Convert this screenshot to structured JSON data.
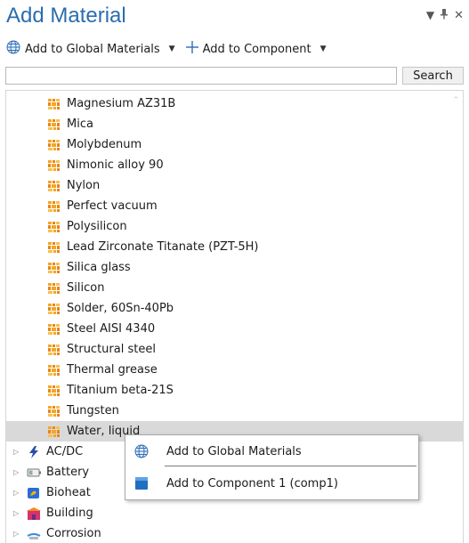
{
  "header": {
    "title": "Add Material",
    "pin_glyph": "▼ ⯇ ✕"
  },
  "toolbar": {
    "add_global_label": "Add to Global Materials",
    "add_component_label": "Add to Component"
  },
  "search": {
    "value": "",
    "button_label": "Search"
  },
  "materials": [
    {
      "label": "Magnesium AZ31B"
    },
    {
      "label": "Mica"
    },
    {
      "label": "Molybdenum"
    },
    {
      "label": "Nimonic alloy 90"
    },
    {
      "label": "Nylon"
    },
    {
      "label": "Perfect vacuum"
    },
    {
      "label": "Polysilicon"
    },
    {
      "label": "Lead Zirconate Titanate (PZT-5H)"
    },
    {
      "label": "Silica glass"
    },
    {
      "label": "Silicon"
    },
    {
      "label": "Solder, 60Sn-40Pb"
    },
    {
      "label": "Steel AISI 4340"
    },
    {
      "label": "Structural steel"
    },
    {
      "label": "Thermal grease"
    },
    {
      "label": "Titanium beta-21S"
    },
    {
      "label": "Tungsten"
    },
    {
      "label": "Water, liquid",
      "selected": true
    }
  ],
  "libraries": [
    {
      "label": "AC/DC",
      "icon": "acdc-icon"
    },
    {
      "label": "Battery",
      "icon": "battery-icon"
    },
    {
      "label": "Bioheat",
      "icon": "bioheat-icon"
    },
    {
      "label": "Building",
      "icon": "building-icon"
    },
    {
      "label": "Corrosion",
      "icon": "corrosion-icon"
    }
  ],
  "context_menu": {
    "items": [
      {
        "label": "Add to Global Materials",
        "icon": "globe-icon"
      },
      {
        "label": "Add to Component 1 (comp1)",
        "icon": "component-icon"
      }
    ]
  },
  "colors": {
    "title": "#2b6cb0",
    "material_icon": "#f5a623",
    "selected_row": "#d9d9d9"
  }
}
